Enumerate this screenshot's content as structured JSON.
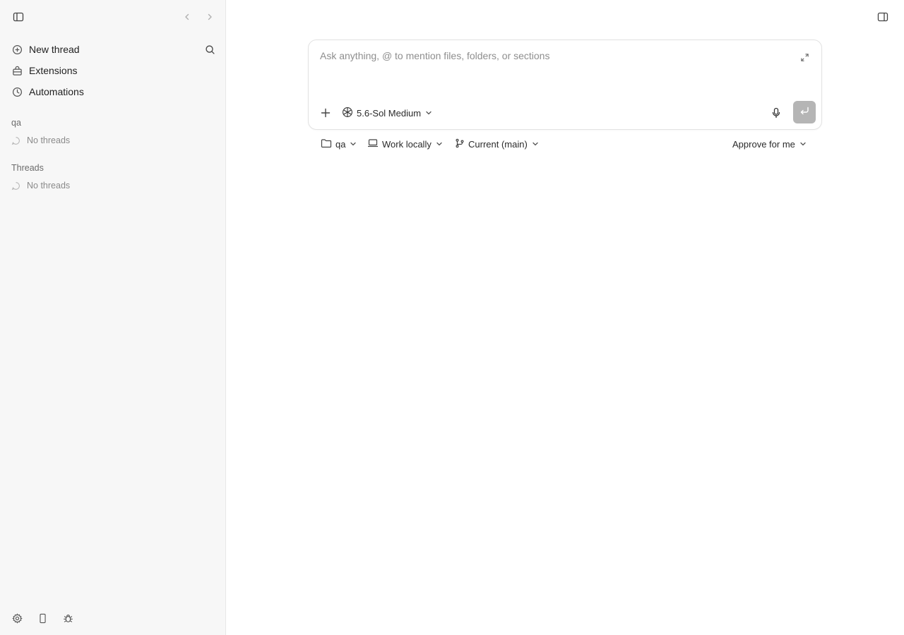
{
  "sidebar": {
    "nav": [
      {
        "label": "New thread",
        "icon": "plus-circle-icon"
      },
      {
        "label": "Extensions",
        "icon": "extensions-icon"
      },
      {
        "label": "Automations",
        "icon": "clock-icon"
      }
    ],
    "sections": [
      {
        "title": "qa",
        "empty_text": "No threads"
      },
      {
        "title": "Threads",
        "empty_text": "No threads"
      }
    ]
  },
  "composer": {
    "placeholder": "Ask anything, @ to mention files, folders, or sections",
    "model_label": "5.6-Sol Medium"
  },
  "context_bar": {
    "project": "qa",
    "environment": "Work locally",
    "branch": "Current (main)",
    "approval": "Approve for me"
  },
  "colors": {
    "sidebar_bg": "#f7f7f7",
    "send_button": "#b5b5b5"
  }
}
